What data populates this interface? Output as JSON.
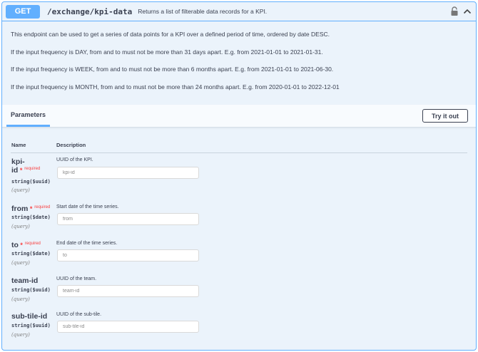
{
  "summary": {
    "method": "GET",
    "path": "/exchange/kpi-data",
    "description": "Returns a list of filterable data records for a KPI."
  },
  "description": [
    "This endpoint can be used to get a series of data points for a KPI over a defined period of time, ordered by date DESC.",
    "If the input frequency is DAY, from and to must not be more than 31 days apart. E.g. from 2021-01-01 to 2021-01-31.",
    "If the input frequency is WEEK, from and to must not be more than 6 months apart. E.g. from 2021-01-01 to 2021-06-30.",
    "If the input frequency is MONTH, from and to must not be more than 24 months apart. E.g. from 2020-01-01 to 2022-12-01"
  ],
  "parameters": {
    "tab_label": "Parameters",
    "try_label": "Try it out",
    "col_name": "Name",
    "col_description": "Description",
    "required_label": "required",
    "items": [
      {
        "name_line1": "kpi-",
        "name_line2": "id",
        "required": true,
        "type": "string($uuid)",
        "in": "(query)",
        "description": "UUID of the KPI.",
        "placeholder": "kpi-id"
      },
      {
        "name_line1": "from",
        "required": true,
        "type": "string($date)",
        "in": "(query)",
        "description": "Start date of the time series.",
        "placeholder": "from"
      },
      {
        "name_line1": "to",
        "required": true,
        "type": "string($date)",
        "in": "(query)",
        "description": "End date of the time series.",
        "placeholder": "to"
      },
      {
        "name_line1": "team-id",
        "required": false,
        "type": "string($uuid)",
        "in": "(query)",
        "description": "UUID of the team.",
        "placeholder": "team-id"
      },
      {
        "name_line1": "sub-tile-id",
        "required": false,
        "type": "string($uuid)",
        "in": "(query)",
        "description": "UUID of the sub-tile.",
        "placeholder": "sub-tile-id"
      }
    ]
  },
  "colors": {
    "accent": "#61affe",
    "required": "#f93e3e",
    "text": "#3b4151",
    "panel": "#ebf3fb"
  },
  "icons": {
    "lock": "lock-icon",
    "collapse": "chevron-up-icon"
  }
}
